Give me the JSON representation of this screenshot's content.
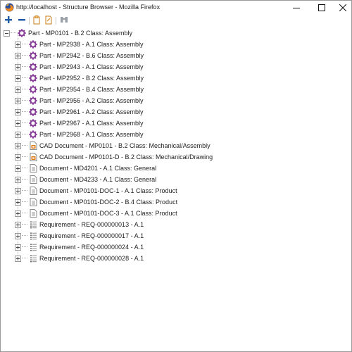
{
  "window": {
    "title": "http://localhost - Structure Browser - Mozilla Firefox"
  },
  "toolbar": {
    "buttons": [
      {
        "name": "expand-all-button",
        "icon": "plus-icon"
      },
      {
        "name": "collapse-all-button",
        "icon": "minus-icon"
      },
      {
        "name": "copy-button",
        "icon": "clipboard-icon"
      },
      {
        "name": "edit-button",
        "icon": "document-edit-icon"
      },
      {
        "name": "compare-button",
        "icon": "binoculars-icon"
      }
    ]
  },
  "tree": {
    "root": {
      "label": "Part - MP0101 - B.2 Class: Assembly",
      "icon": "gear-icon"
    },
    "children": [
      {
        "label": "Part - MP2938 - A.1 Class: Assembly",
        "icon": "gear-icon"
      },
      {
        "label": "Part - MP2942 - B.6 Class: Assembly",
        "icon": "gear-icon"
      },
      {
        "label": "Part - MP2943 - A.1 Class: Assembly",
        "icon": "gear-icon"
      },
      {
        "label": "Part - MP2952 - B.2 Class: Assembly",
        "icon": "gear-icon"
      },
      {
        "label": "Part - MP2954 - B.4 Class: Assembly",
        "icon": "gear-icon"
      },
      {
        "label": "Part - MP2956 - A.2 Class: Assembly",
        "icon": "gear-icon"
      },
      {
        "label": "Part - MP2961 - A.2 Class: Assembly",
        "icon": "gear-icon"
      },
      {
        "label": "Part - MP2967 - A.1 Class: Assembly",
        "icon": "gear-icon"
      },
      {
        "label": "Part - MP2968 - A.1 Class: Assembly",
        "icon": "gear-icon"
      },
      {
        "label": "CAD Document - MP0101 - B.2 Class: Mechanical/Assembly",
        "icon": "cad-document-icon"
      },
      {
        "label": "CAD Document - MP0101-D - B.2 Class: Mechanical/Drawing",
        "icon": "cad-document-icon"
      },
      {
        "label": "Document - MD4201 - A.1 Class: General",
        "icon": "document-icon"
      },
      {
        "label": "Document - MD4233 - A.1 Class: General",
        "icon": "document-icon"
      },
      {
        "label": "Document - MP0101-DOC-1 - A.1 Class: Product",
        "icon": "document-icon"
      },
      {
        "label": "Document - MP0101-DOC-2 - B.4 Class: Product",
        "icon": "document-icon"
      },
      {
        "label": "Document - MP0101-DOC-3 - A.1 Class: Product",
        "icon": "document-icon"
      },
      {
        "label": "Requirement - REQ-000000013 - A.1",
        "icon": "requirement-icon"
      },
      {
        "label": "Requirement - REQ-000000017 - A.1",
        "icon": "requirement-icon"
      },
      {
        "label": "Requirement - REQ-000000024 - A.1",
        "icon": "requirement-icon"
      },
      {
        "label": "Requirement - REQ-000000028 - A.1",
        "icon": "requirement-icon"
      }
    ]
  },
  "colors": {
    "gear": "#8a3a9a",
    "cad": "#e07b1a",
    "doc": "#6b6b6b",
    "toolbar_blue": "#1f5aa8"
  }
}
